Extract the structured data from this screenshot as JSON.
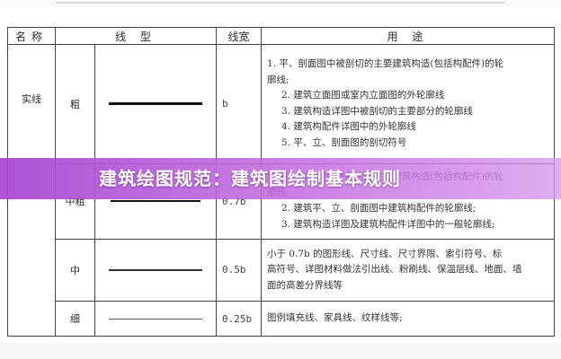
{
  "table": {
    "headers": {
      "name": "名称",
      "type": "线 型",
      "width": "线宽",
      "usage": "用 途"
    },
    "rows": [
      {
        "name": "实线",
        "weight": "粗",
        "width": "b",
        "line_style": "thick",
        "usage": [
          "1. 平、剖面图中被剖切的主要建筑构造(包括构配件)的轮",
          "廓线;",
          "2. 建筑立面图或室内立面图的外轮廓线",
          "3. 建筑构造详图中被剖切的主要部分的轮廓线",
          "4. 建筑构配件详图中的外轮廓线",
          "5. 平、立、剖面图的剖切符号"
        ]
      },
      {
        "name": "",
        "weight": "中粗",
        "width": "0.7b",
        "line_style": "mid-thick",
        "usage": [
          "1. 平、剖面图中被剖切的次要建筑构造(包括构配件)的轮",
          "廓线;",
          "2. 建筑平、立、剖面图中建筑构配件的轮廓线;",
          "3. 建筑构造详图及建筑构配件详图中的一般轮廓线;"
        ]
      },
      {
        "name": "",
        "weight": "中",
        "width": "0.5b",
        "line_style": "medium",
        "usage": [
          "小于 0.7b 的图形线、尺寸线、尺寸界限、索引符号、标",
          "高符号、详图材料做法引出线、粉刷线、保温层线、地面、墙",
          "面的高差分界线等"
        ]
      },
      {
        "name": "",
        "weight": "细",
        "width": "0.25b",
        "line_style": "thin",
        "usage": [
          "图例填充线、家具线、纹样线等;"
        ]
      }
    ]
  },
  "banner": {
    "title": "建筑绘图规范：建筑图绘制基本规则",
    "color": "#b04fd6"
  }
}
